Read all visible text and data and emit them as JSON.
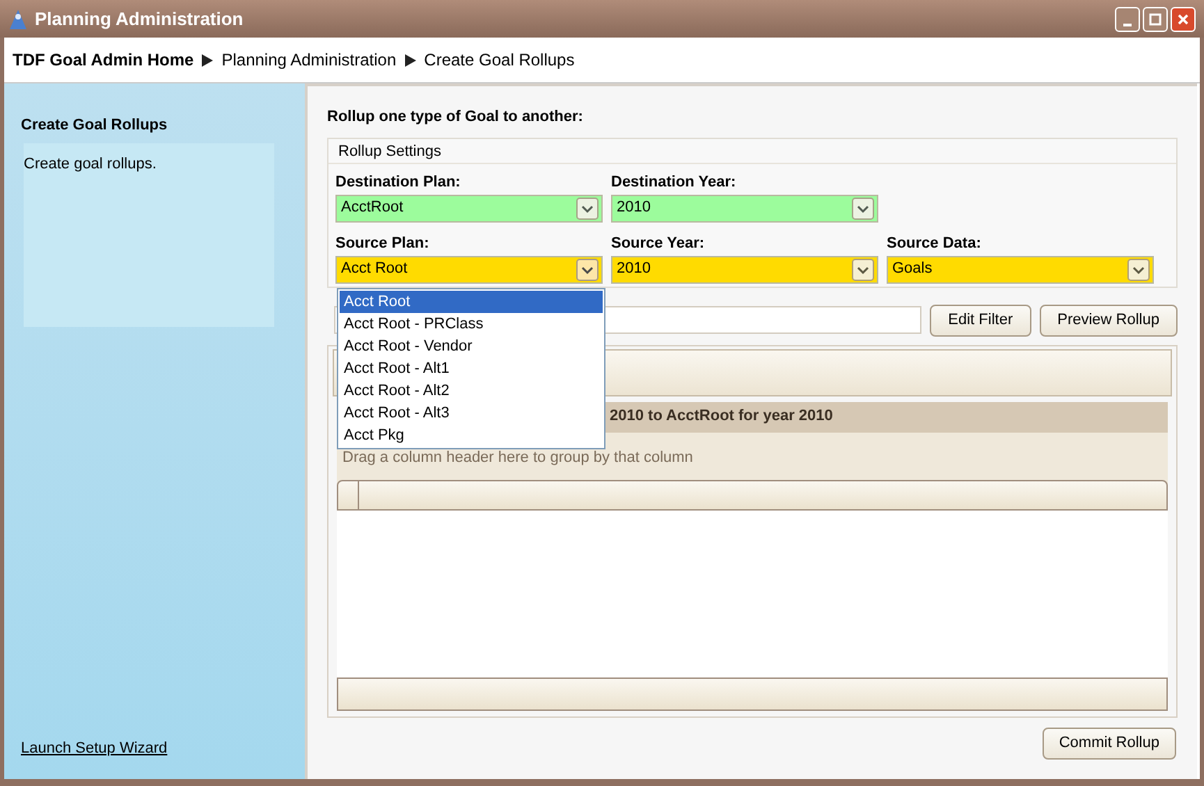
{
  "window": {
    "title": "Planning Administration"
  },
  "breadcrumb": [
    {
      "label": "TDF Goal Admin Home"
    },
    {
      "label": "Planning Administration"
    },
    {
      "label": "Create Goal Rollups"
    }
  ],
  "sidebar": {
    "title": "Create Goal Rollups",
    "description": "Create goal rollups.",
    "link": "Launch Setup Wizard"
  },
  "main": {
    "heading": "Rollup one type of Goal to another:",
    "settings_title": "Rollup Settings",
    "combos": [
      {
        "label": "Destination Plan:",
        "value": "AcctRoot",
        "color": "#9cfc9c",
        "open": false
      },
      {
        "label": "Destination Year:",
        "value": "2010",
        "color": "#9cfc9c",
        "open": false
      },
      {
        "label": "Source Plan:",
        "value": "Acct Root",
        "color": "#ffdb00",
        "open": true
      },
      {
        "label": "Source Year:",
        "value": "2010",
        "color": "#ffdb00",
        "open": false
      },
      {
        "label": "Source Data:",
        "value": "Goals",
        "color": "#ffdb00",
        "open": false
      }
    ],
    "dropdown_options": [
      {
        "label": "Acct Root",
        "selected": true
      },
      {
        "label": "Acct Root - PRClass",
        "selected": false
      },
      {
        "label": "Acct Root - Vendor",
        "selected": false
      },
      {
        "label": "Acct Root - Alt1",
        "selected": false
      },
      {
        "label": "Acct Root - Alt2",
        "selected": false
      },
      {
        "label": "Acct Root - Alt3",
        "selected": false
      },
      {
        "label": "Acct Pkg",
        "selected": false
      }
    ],
    "buttons": [
      "Edit Filter",
      "Preview Rollup"
    ],
    "grid": {
      "title": "2010 to AcctRoot for year 2010",
      "group_hint": "Drag a column header here to group by that column"
    },
    "commit_button": "Commit Rollup"
  }
}
